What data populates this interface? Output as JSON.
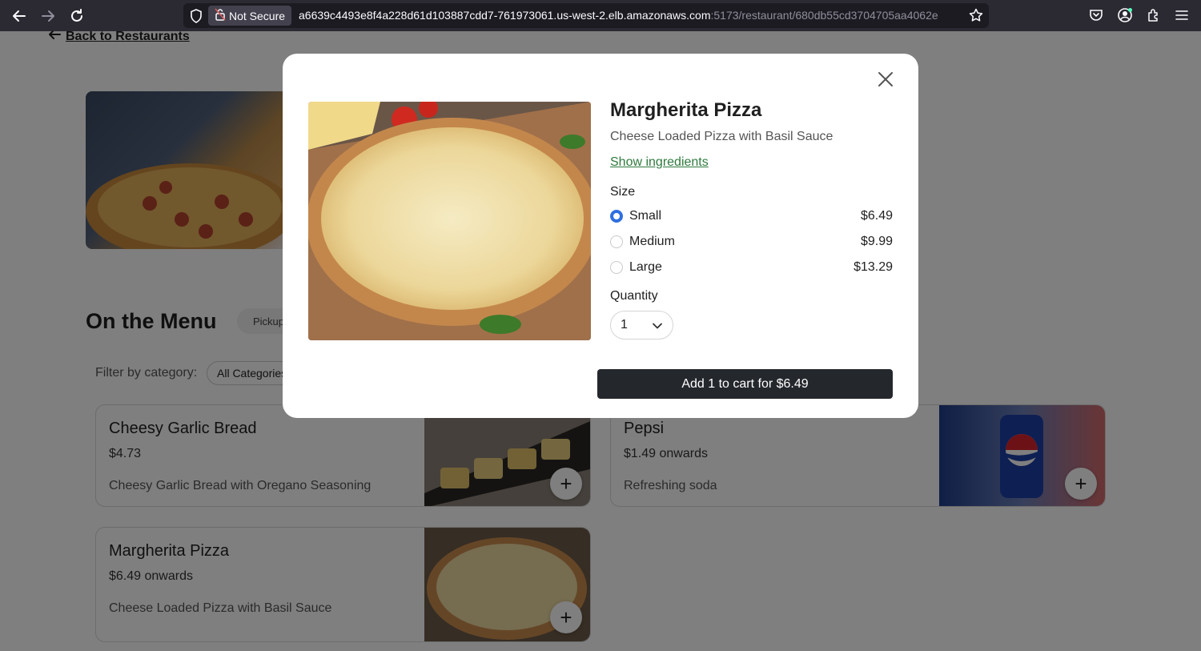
{
  "browser": {
    "security_label": "Not Secure",
    "url_main": "a6639c4493e8f4a228d61d103887cdd7-761973061.us-west-2.elb.amazonaws.com",
    "url_rest": ":5173/restaurant/680db55cd3704705aa4062e"
  },
  "page": {
    "back_label": "Back to Restaurants",
    "menu_title": "On the Menu",
    "pickup_label": "Pickup",
    "filter_label": "Filter by category:",
    "filter_value": "All Categories"
  },
  "cards": [
    {
      "name": "Cheesy Garlic Bread",
      "price": "$4.73",
      "desc": "Cheesy Garlic Bread with Oregano Seasoning",
      "add": "+"
    },
    {
      "name": "Pepsi",
      "price": "$1.49 onwards",
      "desc": "Refreshing soda",
      "add": "+"
    },
    {
      "name": "Margherita Pizza",
      "price": "$6.49 onwards",
      "desc": "Cheese Loaded Pizza with Basil Sauce",
      "add": "+"
    }
  ],
  "modal": {
    "title": "Margherita Pizza",
    "description": "Cheese Loaded Pizza with Basil Sauce",
    "ingredients_link": "Show ingredients",
    "size_label": "Size",
    "sizes": [
      {
        "name": "Small",
        "price": "$6.49",
        "selected": true
      },
      {
        "name": "Medium",
        "price": "$9.99",
        "selected": false
      },
      {
        "name": "Large",
        "price": "$13.29",
        "selected": false
      }
    ],
    "quantity_label": "Quantity",
    "quantity_value": "1",
    "cart_button": "Add 1 to cart for $6.49"
  },
  "colors": {
    "accent_radio": "#2f6fe0",
    "link_green": "#2f7a3e",
    "cart_button_bg": "#24272c",
    "chrome_bg": "#2b2a33"
  }
}
